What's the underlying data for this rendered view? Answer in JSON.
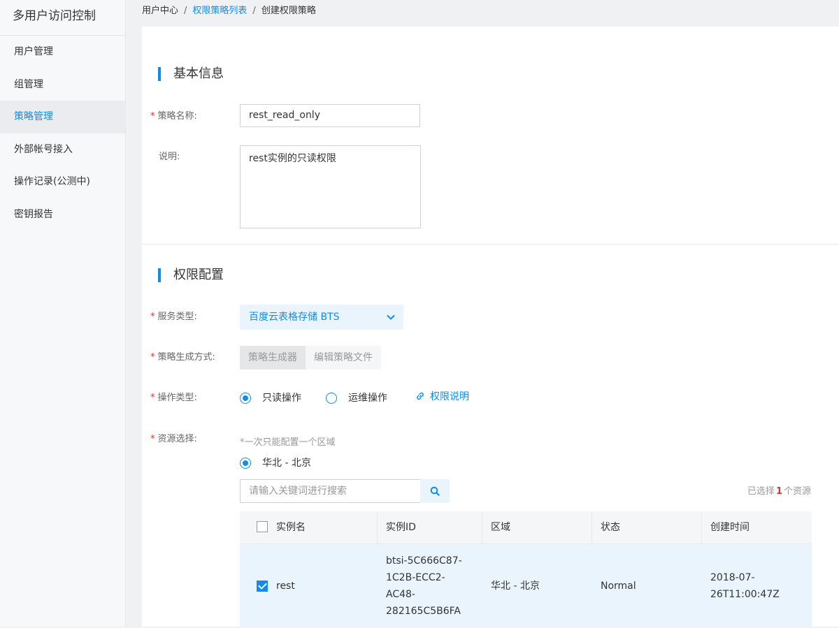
{
  "sidebar": {
    "title": "多用户访问控制",
    "items": [
      {
        "label": "用户管理",
        "active": false
      },
      {
        "label": "组管理",
        "active": false
      },
      {
        "label": "策略管理",
        "active": true
      },
      {
        "label": "外部帐号接入",
        "active": false
      },
      {
        "label": "操作记录(公测中)",
        "active": false
      },
      {
        "label": "密钥报告",
        "active": false
      }
    ]
  },
  "breadcrumb": {
    "root": "用户中心",
    "list": "权限策略列表",
    "current": "创建权限策略",
    "separator": "/"
  },
  "basic": {
    "title": "基本信息",
    "name_label": "策略名称:",
    "name_value": "rest_read_only",
    "desc_label": "说明:",
    "desc_value": "rest实例的只读权限"
  },
  "perm": {
    "title": "权限配置",
    "service_label": "服务类型:",
    "service_value": "百度云表格存储 BTS",
    "method_label": "策略生成方式:",
    "method_options": [
      "策略生成器",
      "编辑策略文件"
    ],
    "op_label": "操作类型:",
    "op_options": [
      "只读操作",
      "运维操作"
    ],
    "op_selected": "只读操作",
    "perm_link": "权限说明",
    "resource_label": "资源选择:",
    "resource_hint": "*一次只能配置一个区域",
    "region_option": "华北 - 北京",
    "search_placeholder": "请输入关键词进行搜索",
    "selected_prefix": "已选择",
    "selected_count": "1",
    "selected_suffix": "个资源"
  },
  "table": {
    "columns": [
      "实例名",
      "实例ID",
      "区域",
      "状态",
      "创建时间"
    ],
    "rows": [
      {
        "checked": true,
        "name": "rest",
        "id": "btsi-5C666C87-1C2B-ECC2-AC48-282165C5B6FA",
        "id_lines": [
          "btsi-5C666C87-",
          "1C2B-ECC2-",
          "AC48-",
          "282165C5B6FA"
        ],
        "region": "华北 - 北京",
        "status": "Normal",
        "created_lines": [
          "2018-07-",
          "26T11:00:47Z"
        ]
      }
    ]
  },
  "colors": {
    "accent": "#108cee",
    "required": "#ea2e2e"
  }
}
